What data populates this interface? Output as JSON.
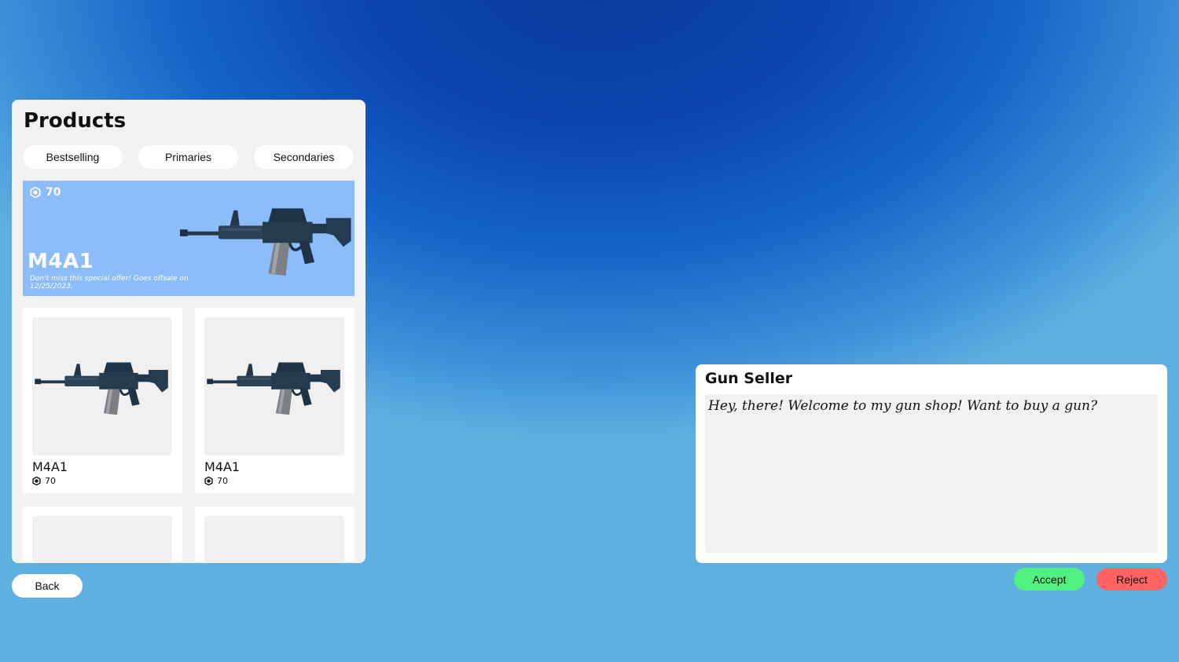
{
  "products": {
    "title": "Products",
    "tabs": [
      {
        "label": "Bestselling"
      },
      {
        "label": "Primaries"
      },
      {
        "label": "Secondaries"
      }
    ],
    "featured": {
      "price": "70",
      "name": "M4A1",
      "description": "Don't miss this special offer! Goes offsale on 12/25/2023."
    },
    "items": [
      {
        "name": "M4A1",
        "price": "70"
      },
      {
        "name": "M4A1",
        "price": "70"
      }
    ],
    "back_label": "Back"
  },
  "dialog": {
    "speaker": "Gun Seller",
    "message": "Hey, there! Welcome to my gun shop! Want to buy a gun?",
    "accept_label": "Accept",
    "reject_label": "Reject"
  },
  "colors": {
    "accept": "#4ff27f",
    "reject": "#ff6363",
    "featured_bg": "#8dbcfa"
  }
}
